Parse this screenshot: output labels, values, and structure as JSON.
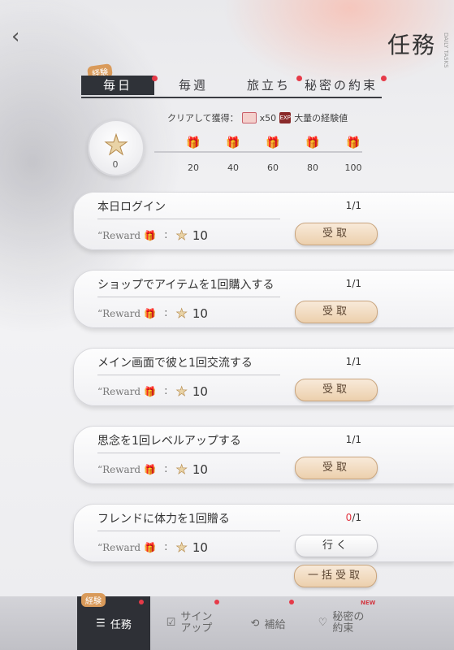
{
  "header": {
    "title": "任務",
    "title_side": "DAILY TASKS",
    "back_icon": "back-arrow-icon"
  },
  "tabs": [
    {
      "label": "毎日",
      "active": true,
      "badge": true
    },
    {
      "label": "毎週",
      "active": false,
      "badge": false
    },
    {
      "label": "旅立ち",
      "active": false,
      "badge": true
    },
    {
      "label": "秘密の約束",
      "active": false,
      "badge": true
    }
  ],
  "exp_badge": "経験",
  "reward_header": {
    "prefix": "クリアして獲得：",
    "ticket_count": "x50",
    "exp_label": "大量の経験値",
    "exp_icon_text": "EXP"
  },
  "progress": {
    "current": "0",
    "milestones": [
      "20",
      "40",
      "60",
      "80",
      "100"
    ]
  },
  "reward_word": "“Reward",
  "colon": ":",
  "tasks": [
    {
      "name": "本日ログイン",
      "done": "1",
      "total": "/1",
      "reward": "10",
      "button": "受取",
      "incomplete": false
    },
    {
      "name": "ショップでアイテムを1回購入する",
      "done": "1",
      "total": "/1",
      "reward": "10",
      "button": "受取",
      "incomplete": false
    },
    {
      "name": "メイン画面で彼と1回交流する",
      "done": "1",
      "total": "/1",
      "reward": "10",
      "button": "受取",
      "incomplete": false
    },
    {
      "name": "思念を1回レベルアップする",
      "done": "1",
      "total": "/1",
      "reward": "10",
      "button": "受取",
      "incomplete": false
    },
    {
      "name": "フレンドに体力を1回贈る",
      "done": "0",
      "total": "/1",
      "reward": "10",
      "button": "行く",
      "incomplete": true
    }
  ],
  "claim_all": "一括受取",
  "bottom_nav": [
    {
      "label": "任務",
      "active": true,
      "badge": true
    },
    {
      "label": "サイン\nアップ",
      "active": false,
      "badge": true
    },
    {
      "label": "補給",
      "active": false,
      "badge": true
    },
    {
      "label": "秘密の\n約束",
      "active": false,
      "badge": false
    }
  ],
  "nav_exp_badge": "経験",
  "new_badge": "NEW",
  "colors": {
    "accent_red": "#e63a48",
    "tab_dark": "#2f3238",
    "claim_gold": "#ecd0ad"
  }
}
